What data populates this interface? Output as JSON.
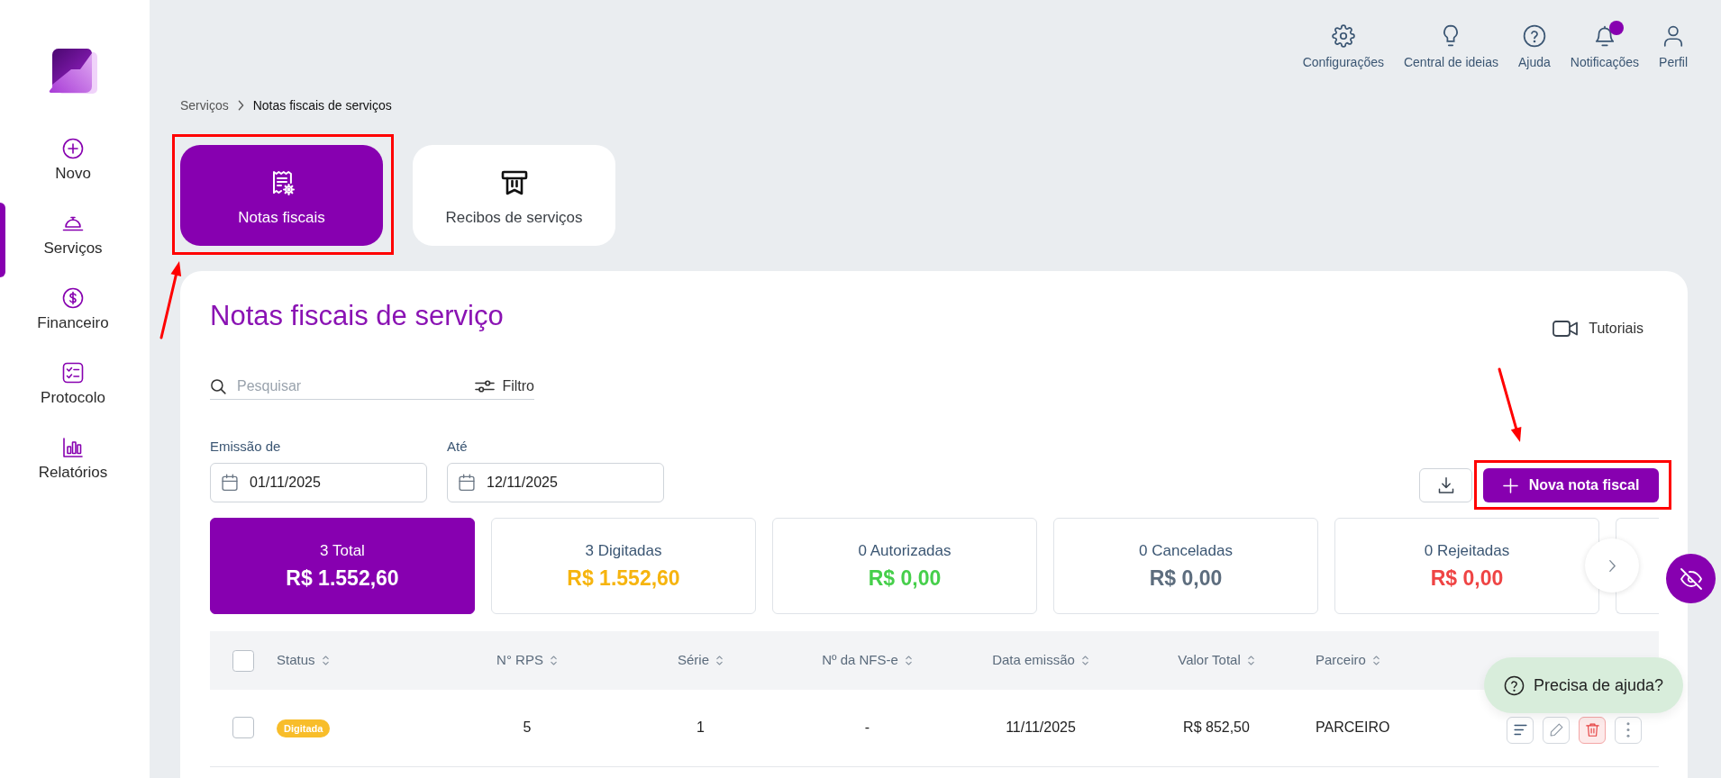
{
  "sidebar": {
    "items": [
      {
        "label": "Novo",
        "selected": false
      },
      {
        "label": "Serviços",
        "selected": true
      },
      {
        "label": "Financeiro",
        "selected": false
      },
      {
        "label": "Protocolo",
        "selected": false
      },
      {
        "label": "Relatórios",
        "selected": false
      }
    ]
  },
  "header": {
    "items": [
      {
        "label": "Configurações",
        "dot": false
      },
      {
        "label": "Central de ideias",
        "dot": false
      },
      {
        "label": "Ajuda",
        "dot": false
      },
      {
        "label": "Notificações",
        "dot": true
      },
      {
        "label": "Perfil",
        "dot": false
      }
    ]
  },
  "breadcrumb": [
    {
      "label": "Serviços",
      "current": false
    },
    {
      "label": "Notas fiscais de serviços",
      "current": true
    }
  ],
  "tabs": [
    {
      "label": "Notas fiscais",
      "selected": true,
      "highlighted": true
    },
    {
      "label": "Recibos de serviços",
      "selected": false,
      "highlighted": false
    }
  ],
  "panel": {
    "title": "Notas fiscais de serviço",
    "tutorials_link": "Tutoriais"
  },
  "search": {
    "placeholder": "Pesquisar",
    "filter_button": "Filtro"
  },
  "date_filters": [
    {
      "label": "Emissão de",
      "value": "01/11/2025"
    },
    {
      "label": "Até",
      "value": "12/11/2025"
    }
  ],
  "new_button": {
    "label": "Nova nota fiscal",
    "highlighted": true
  },
  "stats": [
    {
      "label": "3 Total",
      "value": "R$ 1.552,60",
      "selected": true
    },
    {
      "label": "3 Digitadas",
      "value": "R$ 1.552,60",
      "color": "#f6b40e",
      "selected": false
    },
    {
      "label": "0 Autorizadas",
      "value": "R$ 0,00",
      "color": "#46cf4b",
      "selected": false
    },
    {
      "label": "0 Canceladas",
      "value": "R$ 0,00",
      "color": "#5d6d7e",
      "selected": false
    },
    {
      "label": "0 Rejeitadas",
      "value": "R$ 0,00",
      "color": "#ef4444",
      "selected": false
    }
  ],
  "table": {
    "all_selected": false,
    "columns": [
      "Status",
      "N° RPS",
      "Série",
      "Nº da NFS-e",
      "Data emissão",
      "Valor Total",
      "Parceiro"
    ],
    "rows": [
      {
        "selected": false,
        "color": "#f8bd2a",
        "cells": [
          "Digitada",
          "5",
          "1",
          "-",
          "11/11/2025",
          "R$ 852,50",
          "PARCEIRO"
        ]
      }
    ]
  },
  "help_button": {
    "label": "Precisa de ajuda?"
  }
}
